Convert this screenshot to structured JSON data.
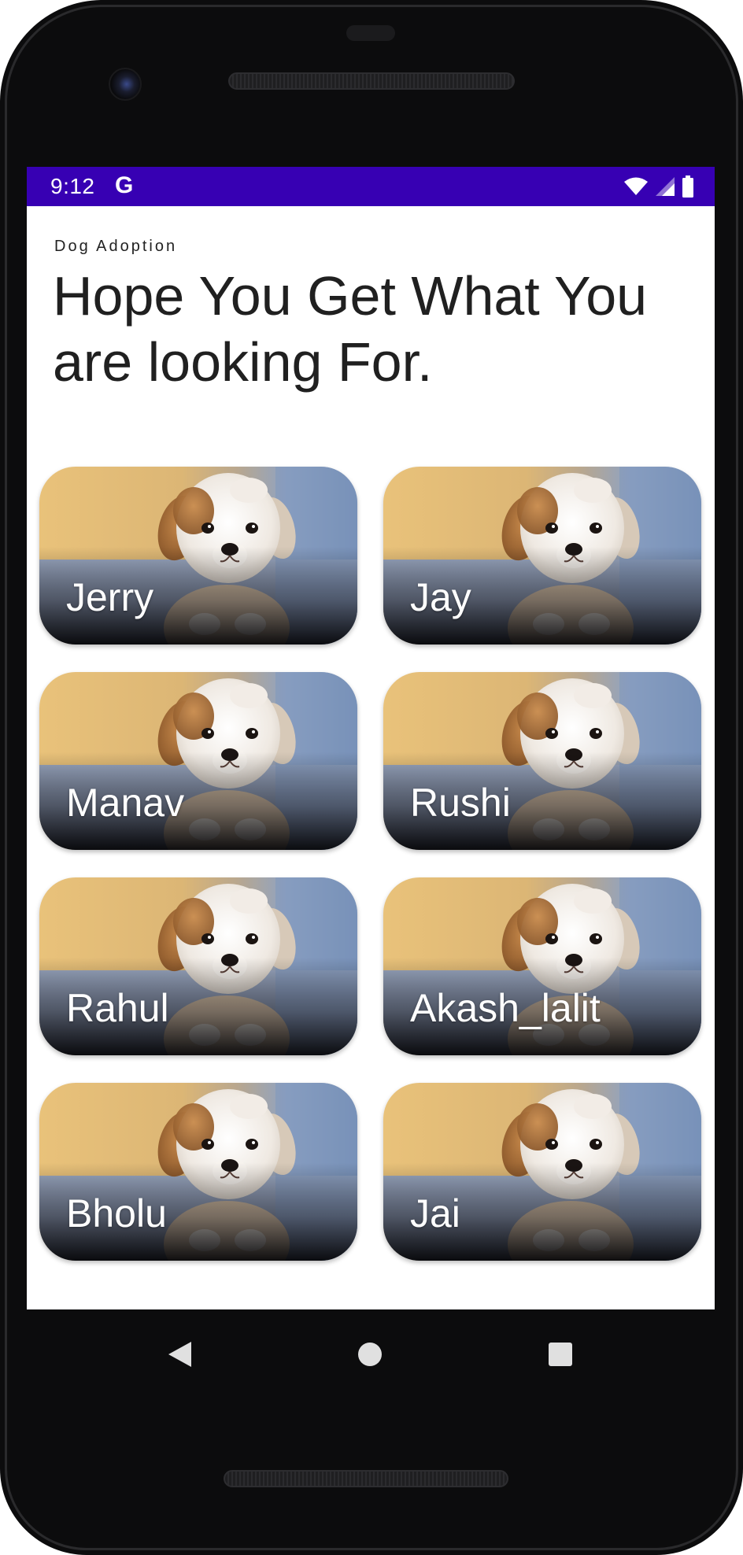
{
  "status_bar": {
    "time": "9:12",
    "google_glyph": "G",
    "background_color": "#3700b3",
    "icons": [
      "wifi-icon",
      "cell-signal-icon",
      "battery-icon"
    ]
  },
  "app": {
    "label": "Dog Adoption",
    "headline": "Hope You Get What You are looking For."
  },
  "dogs": [
    {
      "name": "Jerry",
      "image": "puppy-photo"
    },
    {
      "name": "Jay",
      "image": "puppy-photo"
    },
    {
      "name": "Manav",
      "image": "puppy-photo"
    },
    {
      "name": "Rushi",
      "image": "puppy-photo"
    },
    {
      "name": "Rahul",
      "image": "puppy-photo"
    },
    {
      "name": "Akash_lalit",
      "image": "puppy-photo"
    },
    {
      "name": "Bholu",
      "image": "puppy-photo"
    },
    {
      "name": "Jai",
      "image": "puppy-photo"
    }
  ],
  "navigation": {
    "buttons": [
      "back-icon",
      "home-icon",
      "recents-icon"
    ]
  }
}
